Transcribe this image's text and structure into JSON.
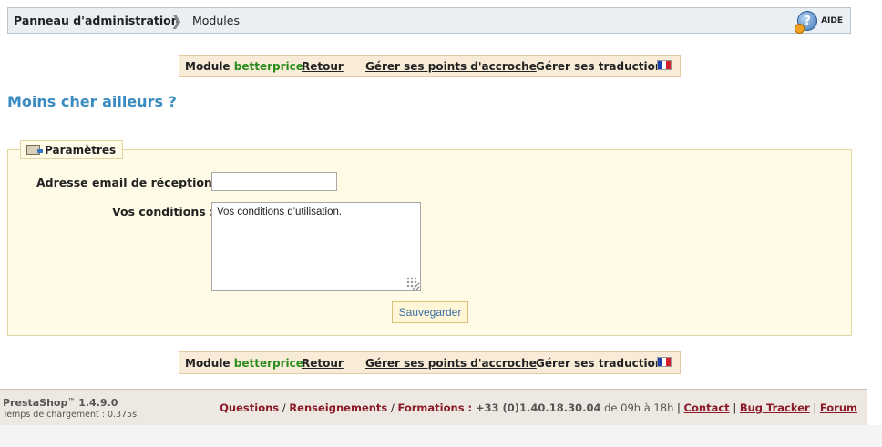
{
  "breadcrumb": {
    "home": "Panneau d'administration",
    "separator": "❯",
    "current": "Modules"
  },
  "help": {
    "label": "AIDE"
  },
  "module_bar": {
    "prefix": "Module",
    "module_name": "betterprice",
    "back": "Retour",
    "hooks": "Gérer ses points d'accroche",
    "translations": "Gérer ses traductions",
    "flag_colors": [
      "#1c3fa8",
      "#ffffff",
      "#d3232a"
    ]
  },
  "page_title": "Moins cher ailleurs ?",
  "settings": {
    "legend": "Paramètres",
    "email_label": "Adresse email de réception :",
    "email_value": "",
    "conditions_label": "Vos conditions :",
    "conditions_value": "Vos conditions d'utilisation.",
    "save_button": "Sauvegarder"
  },
  "footer": {
    "version_name": "PrestaShop",
    "version_tm": "™",
    "version_number": "1.4.9.0",
    "load_time": "Temps de chargement : 0.375s",
    "questions": "Questions",
    "sep1": "/",
    "info": "Renseignements",
    "sep2": "/",
    "training": "Formations :",
    "phone": "+33 (0)1.40.18.30.04",
    "hours": "de 09h à 18h",
    "pipe": "|",
    "contact": "Contact",
    "bug_tracker": "Bug Tracker",
    "forum": "Forum"
  }
}
